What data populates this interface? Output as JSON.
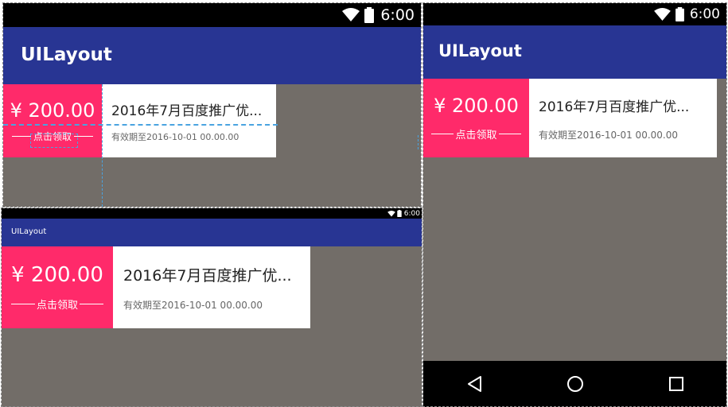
{
  "status": {
    "time": "6:00",
    "wifi_icon": "wifi-icon",
    "battery_icon": "battery-icon"
  },
  "app": {
    "title": "UILayout"
  },
  "coupon": {
    "amount": "¥ 200.00",
    "claim_label": "点击领取",
    "title": "2016年7月百度推广优...",
    "validity": "有效期至2016-10-01 00.00.00"
  },
  "navigation": {
    "back_icon": "back-icon",
    "home_icon": "home-icon",
    "recents_icon": "recents-icon"
  },
  "colors": {
    "appbar": "#283593",
    "coupon_accent": "#ff2a6a",
    "background": "#726d68",
    "statusbar": "#000000",
    "guide_line": "#4aa3e0"
  }
}
